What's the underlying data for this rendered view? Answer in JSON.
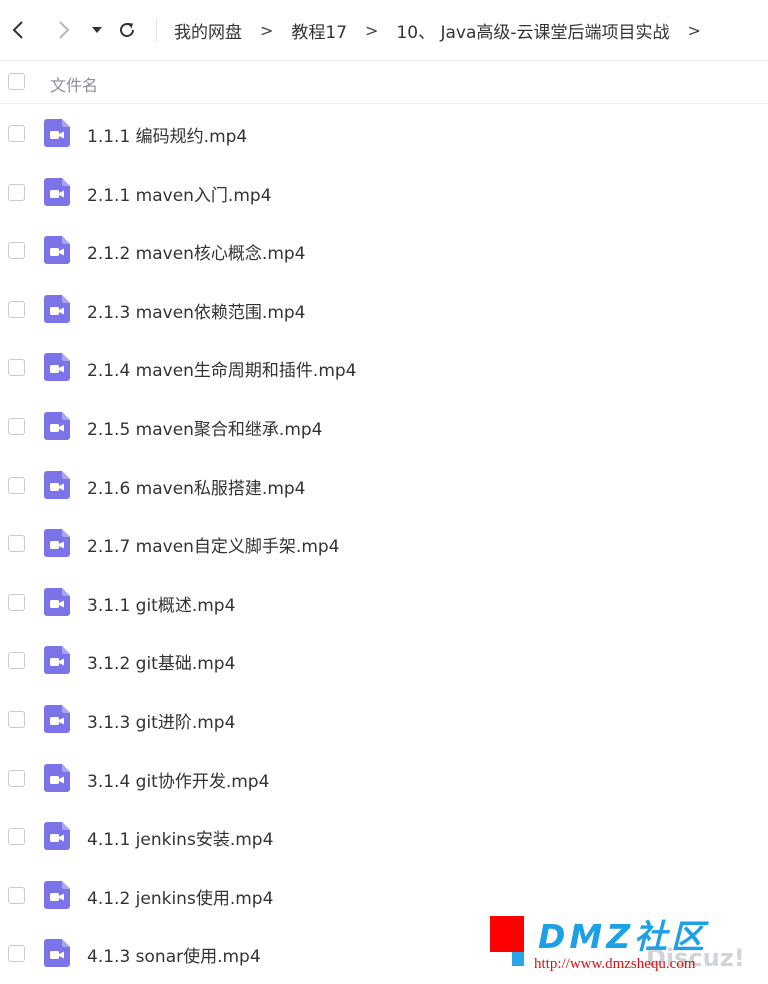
{
  "breadcrumb": [
    "我的网盘",
    "教程17",
    "10、 Java高级-云课堂后端项目实战"
  ],
  "breadcrumb_separator": ">",
  "toolbar_icons": {
    "back": "chevron-left-icon",
    "forward": "chevron-right-icon",
    "history": "caret-down-icon",
    "refresh": "refresh-icon"
  },
  "list_header": {
    "name_label": "文件名"
  },
  "files": [
    {
      "name": "1.1.1 编码规约.mp4"
    },
    {
      "name": "2.1.1 maven入门.mp4"
    },
    {
      "name": "2.1.2 maven核心概念.mp4"
    },
    {
      "name": "2.1.3 maven依赖范围.mp4"
    },
    {
      "name": "2.1.4 maven生命周期和插件.mp4"
    },
    {
      "name": "2.1.5 maven聚合和继承.mp4"
    },
    {
      "name": "2.1.6 maven私服搭建.mp4"
    },
    {
      "name": "2.1.7 maven自定义脚手架.mp4"
    },
    {
      "name": "3.1.1 git概述.mp4"
    },
    {
      "name": "3.1.2 git基础.mp4"
    },
    {
      "name": "3.1.3 git进阶.mp4"
    },
    {
      "name": "3.1.4 git协作开发.mp4"
    },
    {
      "name": "4.1.1 jenkins安装.mp4"
    },
    {
      "name": "4.1.2 jenkins使用.mp4"
    },
    {
      "name": "4.1.3 sonar使用.mp4"
    }
  ],
  "file_icon": "video-file-icon",
  "colors": {
    "video_icon": "#7b73e8",
    "watermark_blue": "#1ea0e6",
    "watermark_red": "#ff0000"
  },
  "watermark": {
    "title": "DMZ社区",
    "url": "http://www.dmzshequ.com",
    "brand": "Discuz!"
  }
}
